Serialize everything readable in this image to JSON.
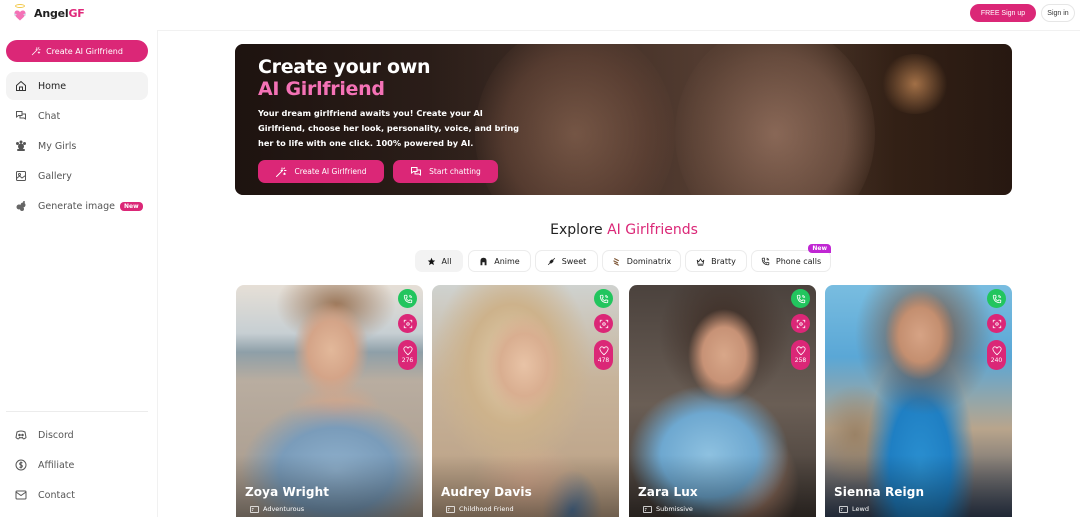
{
  "header": {
    "logo_text_primary": "Angel",
    "logo_text_accent": "GF",
    "signup_label": "FREE Sign up",
    "signin_label": "Sign in"
  },
  "sidebar": {
    "create_label": "Create AI Girlfriend",
    "items": [
      {
        "label": "Home",
        "icon": "home-icon",
        "active": true
      },
      {
        "label": "Chat",
        "icon": "chat-icon"
      },
      {
        "label": "My Girls",
        "icon": "my-girls-icon"
      },
      {
        "label": "Gallery",
        "icon": "gallery-icon"
      },
      {
        "label": "Generate image",
        "icon": "generate-image-icon",
        "badge": "New"
      }
    ],
    "footer_items": [
      {
        "label": "Discord",
        "icon": "discord-icon"
      },
      {
        "label": "Affiliate",
        "icon": "dollar-icon"
      },
      {
        "label": "Contact",
        "icon": "mail-icon"
      }
    ]
  },
  "hero": {
    "title_line1": "Create your own",
    "title_line2": "AI Girlfriend",
    "description": "Your dream girlfriend awaits you! Create your AI Girlfriend, choose her look, personality, voice, and bring her to life with one click. 100% powered by AI.",
    "create_button": "Create AI Girlfriend",
    "chat_button": "Start chatting"
  },
  "explore": {
    "title_prefix": "Explore",
    "title_accent": "AI Girlfriends",
    "filters": [
      {
        "label": "All",
        "icon": "star-icon",
        "active": true
      },
      {
        "label": "Anime",
        "icon": "anime-icon"
      },
      {
        "label": "Sweet",
        "icon": "candy-icon"
      },
      {
        "label": "Dominatrix",
        "icon": "whip-icon"
      },
      {
        "label": "Bratty",
        "icon": "crown-icon"
      },
      {
        "label": "Phone calls",
        "icon": "phone-icon",
        "badge": "New"
      }
    ]
  },
  "cards": [
    {
      "name": "Zoya Wright",
      "tag": "Adventurous",
      "likes": "276"
    },
    {
      "name": "Audrey Davis",
      "tag": "Childhood Friend",
      "likes": "478"
    },
    {
      "name": "Zara Lux",
      "tag": "Submissive",
      "likes": "258"
    },
    {
      "name": "Sienna Reign",
      "tag": "Lewd",
      "likes": "240"
    }
  ],
  "colors": {
    "brand_pink": "#db2777",
    "call_green": "#22c55e",
    "new_badge_purple": "#c026d3"
  }
}
